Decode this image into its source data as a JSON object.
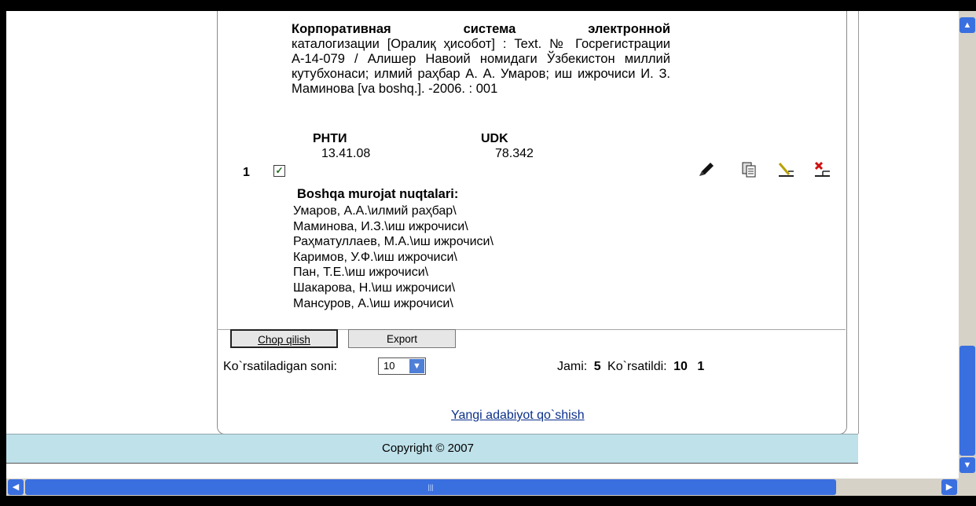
{
  "record": {
    "title": "Корпоративная система электронной",
    "body": "каталогизации [Оралиқ ҳисобот] : Text. № Госрегистрации А-14-079 / Алишер Навоий номидаги Ўзбекистон миллий кутубхонаси; илмий раҳбар А. А. Умаров; иш ижрочиси И. З. Маминова [va boshq.]. -2006. : 001",
    "codes": {
      "rnti_label": "РНТИ",
      "rnti_value": "13.41.08",
      "udk_label": "UDK",
      "udk_value": "78.342"
    },
    "row_number": "1",
    "checkbox_mark": "✓",
    "access_points_title": "Boshqa murojat nuqtalari:",
    "access_points": [
      "Умаров, А.А.\\илмий раҳбар\\",
      "Маминова, И.З.\\иш ижрочиси\\",
      "Раҳматуллаев, М.А.\\иш ижрочиси\\",
      "Каримов, У.Ф.\\иш ижрочиси\\",
      "Пан, Т.Е.\\иш ижрочиси\\",
      "Шакарова, Н.\\иш ижрочиси\\",
      "Мансуров, А.\\иш ижрочиси\\"
    ]
  },
  "actions": {
    "icons": [
      "pencil-icon",
      "copy-icon",
      "edit-record-icon",
      "delete-record-icon"
    ]
  },
  "buttons": {
    "print_label": "Chop qilish",
    "export_label": "Export"
  },
  "count": {
    "label": "Ko`rsatiladigan soni:",
    "selected": "10"
  },
  "totals": {
    "total_label": "Jami:",
    "total_value": "5",
    "shown_label": "Ko`rsatildi:",
    "shown_value": "10",
    "page": "1"
  },
  "add_link": "Yangi adabiyot qo`shish",
  "footer": {
    "copyright": "Copyright © 2007"
  },
  "scrollbars": {
    "vertical_up": "▲",
    "vertical_down": "▼",
    "horizontal_left": "◀",
    "horizontal_right": "▶",
    "grip": "|||"
  },
  "colors": {
    "footer_bg": "#bfe1ea",
    "scroll_blue": "#3a6fe0",
    "link": "#0b2f8a"
  }
}
